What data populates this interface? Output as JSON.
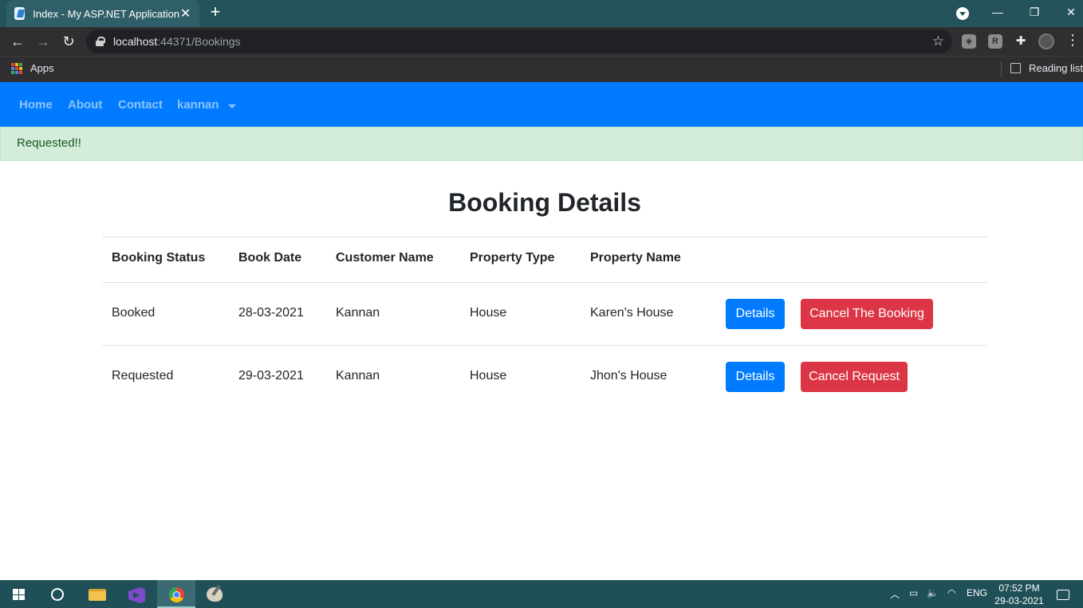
{
  "browser": {
    "tab_title": "Index - My ASP.NET Application",
    "tab_close": "✕",
    "new_tab": "+",
    "url_host": "localhost",
    "url_rest": ":44371/Bookings",
    "bookmarks_apps": "Apps",
    "reading_list": "Reading list",
    "window_minimize": "—",
    "window_restore": "❐",
    "window_close": "✕"
  },
  "navbar": {
    "links": [
      "Home",
      "About",
      "Contact"
    ],
    "user": "kannan",
    "color": "#007bff"
  },
  "alert": {
    "text": "Requested!!",
    "background": "#d4edda"
  },
  "page": {
    "title": "Booking Details"
  },
  "table": {
    "headers": [
      "Booking Status",
      "Book Date",
      "Customer Name",
      "Property Type",
      "Property Name"
    ],
    "rows": [
      {
        "status": "Booked",
        "date": "28-03-2021",
        "customer": "Kannan",
        "type": "House",
        "property": "Karen's House",
        "details_label": "Details",
        "cancel_label": "Cancel The Booking"
      },
      {
        "status": "Requested",
        "date": "29-03-2021",
        "customer": "Kannan",
        "type": "House",
        "property": "Jhon's House",
        "details_label": "Details",
        "cancel_label": "Cancel Request"
      }
    ],
    "primary_color": "#007bff",
    "danger_color": "#dc3545"
  },
  "taskbar": {
    "language": "ENG",
    "time": "07:52 PM",
    "date": "29-03-2021",
    "apps": [
      "windows-start-icon",
      "cortana-icon",
      "file-explorer-icon",
      "visual-studio-icon",
      "chrome-icon",
      "paint-icon"
    ]
  }
}
